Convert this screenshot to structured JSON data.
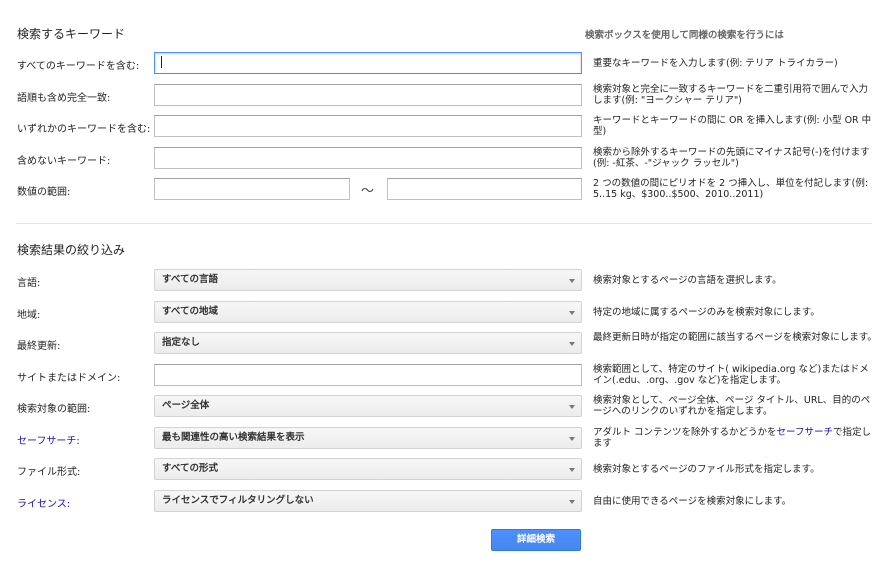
{
  "keywords_section": {
    "title": "検索するキーワード",
    "side_header": "検索ボックスを使用して同様の検索を行うには",
    "rows": [
      {
        "label": "すべてのキーワードを含む:",
        "value": "",
        "help": "重要なキーワードを入力します(例: テリア トライカラー)"
      },
      {
        "label": "語順も含め完全一致:",
        "value": "",
        "help": "検索対象と完全に一致するキーワードを二重引用符で囲んで入力します(例: \"ヨークシャー テリア\")"
      },
      {
        "label": "いずれかのキーワードを含む:",
        "value": "",
        "help": "キーワードとキーワードの間に OR を挿入します(例: 小型 OR 中型)"
      },
      {
        "label": "含めないキーワード:",
        "value": "",
        "help": "検索から除外するキーワードの先頭にマイナス記号(-)を付けます(例: -紅茶、-\"ジャック ラッセル\")"
      }
    ],
    "range": {
      "label": "数値の範囲:",
      "separator": "〜",
      "from": "",
      "to": "",
      "help": "2 つの数値の間にピリオドを 2 つ挿入し、単位を付記します(例: 5..15 kg、$300..$500、2010..2011)"
    }
  },
  "narrow_section": {
    "title": "検索結果の絞り込み",
    "rows": [
      {
        "label": "言語:",
        "selected": "すべての言語",
        "help": "検索対象とするページの言語を選択します。"
      },
      {
        "label": "地域:",
        "selected": "すべての地域",
        "help": "特定の地域に属するページのみを検索対象にします。"
      },
      {
        "label": "最終更新:",
        "selected": "指定なし",
        "help": "最終更新日時が指定の範囲に該当するページを検索対象にします。"
      },
      {
        "label": "サイトまたはドメイン:",
        "value": "",
        "help": "検索範囲として、特定のサイト( wikipedia.org など)またはドメイン(.edu、.org、.gov など)を指定します。"
      },
      {
        "label": "検索対象の範囲:",
        "selected": "ページ全体",
        "help": "検索対象として、ページ全体、ページ タイトル、URL、目的のページへのリンクのいずれかを指定します。"
      },
      {
        "label": "セーフサーチ:",
        "selected": "最も関連性の高い検索結果を表示",
        "help_before": "アダルト コンテンツを除外するかどうかを",
        "help_link": "セーフサーチ",
        "help_after": "で指定します"
      },
      {
        "label": "ファイル形式:",
        "selected": "すべての形式",
        "help": "検索対象とするページのファイル形式を指定します。"
      },
      {
        "label": "ライセンス:",
        "selected": "ライセンスでフィルタリングしない",
        "help": "自由に使用できるページを検索対象にします。"
      }
    ]
  },
  "submit_label": "詳細検索",
  "colors": {
    "link": "#1a0dab",
    "button": "#4d90fe",
    "focus_border": "#4d90fe"
  }
}
